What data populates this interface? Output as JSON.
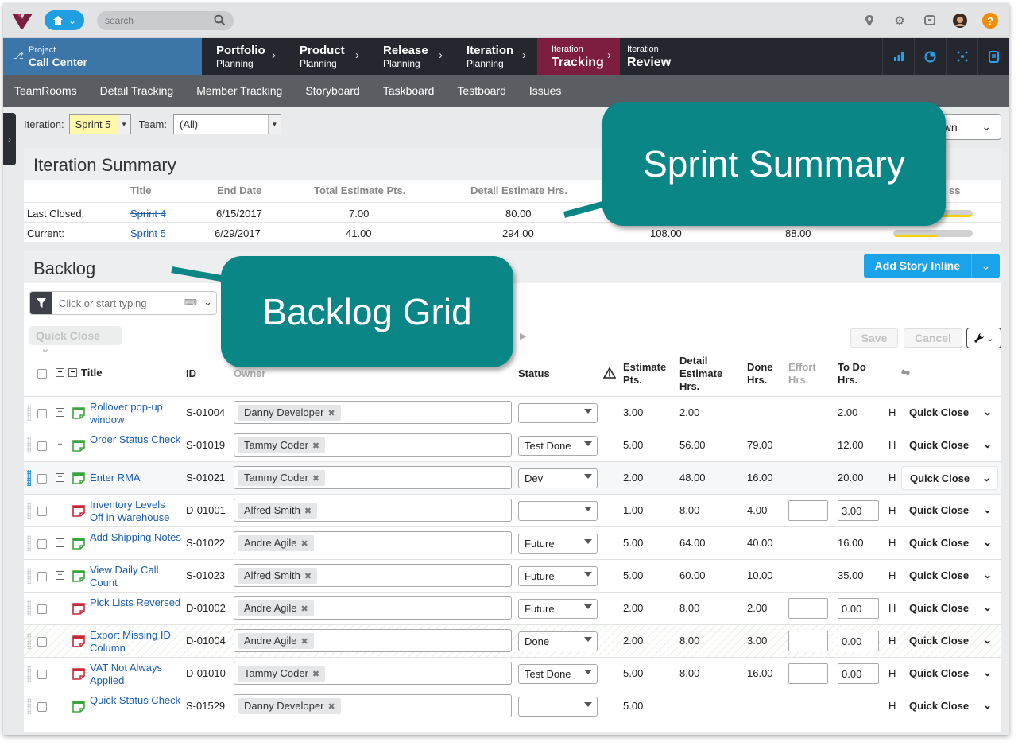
{
  "topbar": {
    "search_placeholder": "search",
    "icons": [
      "logo-icon",
      "home-icon",
      "search-icon",
      "pin-icon",
      "gear-icon",
      "chat-icon",
      "avatar",
      "help-icon"
    ],
    "help_label": "?"
  },
  "nav": {
    "project_label": "Project",
    "project_name": "Call Center",
    "tabs": [
      {
        "top": "Portfolio",
        "bottom": "Planning"
      },
      {
        "top": "Product",
        "bottom": "Planning"
      },
      {
        "top": "Release",
        "bottom": "Planning"
      },
      {
        "top": "Iteration",
        "bottom": "Planning"
      },
      {
        "top": "Iteration",
        "bottom": "Tracking"
      },
      {
        "top": "Iteration",
        "bottom": "Review"
      }
    ],
    "right_icons": [
      "bar-chart-icon",
      "pie-chart-icon",
      "network-icon",
      "notes-icon"
    ]
  },
  "subnav": [
    "TeamRooms",
    "Detail Tracking",
    "Member Tracking",
    "Storyboard",
    "Taskboard",
    "Testboard",
    "Issues"
  ],
  "filters": {
    "iteration_label": "Iteration:",
    "iteration_value": "Sprint 5",
    "team_label": "Team:",
    "team_value": "(All)",
    "breakdown_partial": "own"
  },
  "summary": {
    "title": "Iteration Summary",
    "headers": [
      "Title",
      "End Date",
      "Total Estimate Pts.",
      "Detail Estimate Hrs.",
      "ss"
    ],
    "rows": [
      {
        "label": "Last Closed:",
        "title": "Sprint 4",
        "end": "6/15/2017",
        "pts": "7.00",
        "hrs": "80.00",
        "done": "",
        "todo": "",
        "progress": 1.0
      },
      {
        "label": "Current:",
        "title": "Sprint 5",
        "end": "6/29/2017",
        "pts": "41.00",
        "hrs": "294.00",
        "done": "108.00",
        "todo": "88.00",
        "progress": 0.55
      }
    ]
  },
  "backlog": {
    "title": "Backlog",
    "add_story": "Add Story Inline",
    "filter_placeholder": "Click or start typing",
    "quick_close_bulk": "Quick Close",
    "save": "Save",
    "cancel": "Cancel",
    "columns": {
      "title": "Title",
      "id": "ID",
      "owner": "Owner",
      "status": "Status",
      "estimate": "Estimate Pts.",
      "detail": "Detail Estimate Hrs.",
      "done": "Done Hrs.",
      "effort": "Effort Hrs.",
      "todo": "To Do Hrs."
    },
    "rows": [
      {
        "title": "Rollover pop-up window",
        "id": "S-01004",
        "owner": "Danny Developer",
        "status": "",
        "est": "3.00",
        "detail": "2.00",
        "done": "",
        "todo": "2.00",
        "h": "H",
        "action": "Quick Close",
        "type": "story",
        "expand": true,
        "inputs": false
      },
      {
        "title": "Order Status Check",
        "id": "S-01019",
        "owner": "Tammy Coder",
        "status": "Test Done",
        "est": "5.00",
        "detail": "56.00",
        "done": "79.00",
        "todo": "12.00",
        "h": "H",
        "action": "Quick Close",
        "type": "story",
        "expand": true,
        "inputs": false
      },
      {
        "title": "Enter RMA",
        "id": "S-01021",
        "owner": "Tammy Coder",
        "status": "Dev",
        "est": "2.00",
        "detail": "48.00",
        "done": "16.00",
        "todo": "20.00",
        "h": "H",
        "action": "Quick Close",
        "type": "story",
        "expand": true,
        "inputs": false
      },
      {
        "title": "Inventory Levels Off in Warehouse",
        "id": "D-01001",
        "owner": "Alfred Smith",
        "status": "",
        "est": "1.00",
        "detail": "8.00",
        "done": "4.00",
        "todo": "3.00",
        "h": "H",
        "action": "Quick Close",
        "type": "defect",
        "expand": false,
        "inputs": true
      },
      {
        "title": "Add Shipping Notes",
        "id": "S-01022",
        "owner": "Andre Agile",
        "status": "Future",
        "est": "5.00",
        "detail": "64.00",
        "done": "40.00",
        "todo": "16.00",
        "h": "H",
        "action": "Quick Close",
        "type": "story",
        "expand": true,
        "inputs": false
      },
      {
        "title": "View Daily Call Count",
        "id": "S-01023",
        "owner": "Alfred Smith",
        "status": "Future",
        "est": "5.00",
        "detail": "60.00",
        "done": "10.00",
        "todo": "35.00",
        "h": "H",
        "action": "Quick Close",
        "type": "story",
        "expand": true,
        "inputs": false
      },
      {
        "title": "Pick Lists Reversed",
        "id": "D-01002",
        "owner": "Andre Agile",
        "status": "Future",
        "est": "2.00",
        "detail": "8.00",
        "done": "2.00",
        "todo": "0.00",
        "h": "H",
        "action": "Quick Close",
        "type": "defect",
        "expand": false,
        "inputs": true
      },
      {
        "title": "Export Missing ID Column",
        "id": "D-01004",
        "owner": "Andre Agile",
        "status": "Done",
        "est": "2.00",
        "detail": "8.00",
        "done": "3.00",
        "todo": "0.00",
        "h": "H",
        "action": "Quick Close",
        "type": "defect",
        "expand": false,
        "inputs": true
      },
      {
        "title": "VAT Not Always Applied",
        "id": "D-01010",
        "owner": "Tammy Coder",
        "status": "Test Done",
        "est": "5.00",
        "detail": "8.00",
        "done": "16.00",
        "todo": "0.00",
        "h": "H",
        "action": "Quick Close",
        "type": "defect",
        "expand": false,
        "inputs": true
      },
      {
        "title": "Quick Status Check",
        "id": "S-01529",
        "owner": "Danny Developer",
        "status": "",
        "est": "5.00",
        "detail": "",
        "done": "",
        "todo": "",
        "h": "H",
        "action": "Quick Close",
        "type": "story",
        "expand": false,
        "inputs": false
      }
    ]
  },
  "callouts": {
    "sprint_summary": "Sprint Summary",
    "backlog_grid": "Backlog Grid"
  },
  "colors": {
    "accent": "#1aa3e8",
    "nav_dark": "#24272d",
    "active_tab": "#7d1d3f",
    "project": "#3c75a8",
    "callout": "#0a8686",
    "progress": "#f5d300"
  }
}
